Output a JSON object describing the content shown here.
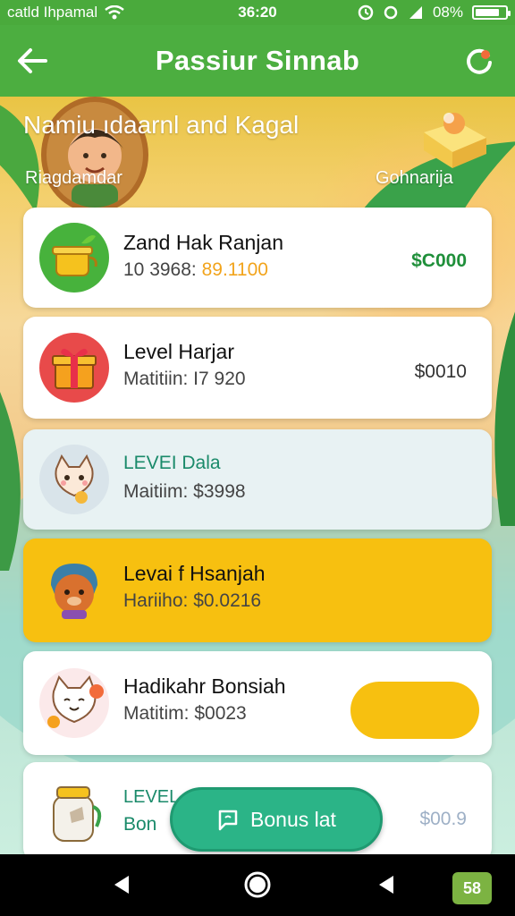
{
  "status_bar": {
    "carrier": "catld Ihpamal",
    "time": "36:20",
    "battery": "08%"
  },
  "app_bar": {
    "title": "Passiur Sinnab"
  },
  "hero": {
    "title": "Namiu ıdaarnl and Kagal",
    "left_label": "Riagdamdar",
    "right_label": "Gohnarija"
  },
  "cards": [
    {
      "title": "Zand Hak Ranjan",
      "sub_prefix": "10 3968: ",
      "sub_accent": "89.1100",
      "amount": "$C000"
    },
    {
      "title": "Level Harjar",
      "sub": "Matitiin: I7 920",
      "amount": "$0010"
    },
    {
      "title": "LEVEI Dala",
      "sub": "Maitiim: $3998"
    },
    {
      "title": "Levai f Hsanjah",
      "sub": "Hariiho: $0.0216"
    },
    {
      "title": "Hadikahr Bonsiah",
      "sub": "Matitim: $0023"
    },
    {
      "title": "LEVEL",
      "sub": "Bon",
      "amount": "$00.9"
    }
  ],
  "fab": {
    "label": "Bonus lat"
  },
  "nav_badge": "58",
  "colors": {
    "primary_green": "#4cae40",
    "accent_yellow": "#f7c010",
    "fab_teal": "#2bb487",
    "amount_green": "#1f8f3a"
  },
  "icons": [
    "back-arrow-icon",
    "refresh-icon",
    "wifi-icon",
    "signal-icon",
    "pot-icon",
    "gift-icon",
    "cat-icon",
    "bear-icon",
    "kitten-icon",
    "jar-icon",
    "chat-icon",
    "back-nav-icon",
    "home-nav-icon",
    "recents-nav-icon"
  ]
}
